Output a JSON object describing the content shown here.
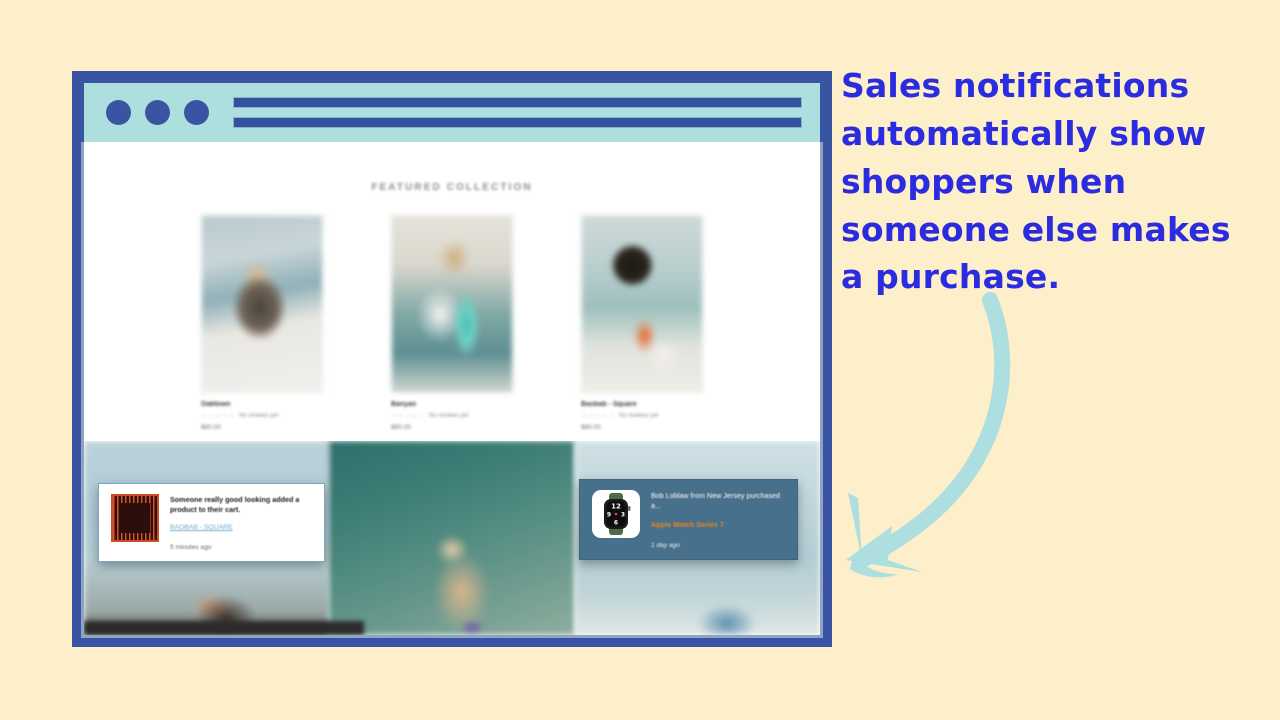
{
  "headline": "Sales notifications automatically show shoppers when someone else makes a purchase.",
  "colors": {
    "background": "#FCEFC9",
    "frame_blue": "#3A54A4",
    "chrome_teal": "#AEDFDF",
    "headline_blue": "#2B2BE0",
    "arrow_teal": "#ADDEE0",
    "notification_right_bg": "#46708C",
    "product_link_orange": "#E8871E",
    "product_link_blue": "#6FA8CF"
  },
  "browser": {
    "chrome": {
      "dots": [
        "window-dot-red",
        "window-dot-yellow",
        "window-dot-green"
      ],
      "address_bars": 2
    },
    "page": {
      "collection_title": "FEATURED COLLECTION",
      "products": [
        {
          "name": "Oaktown",
          "stars": "☆☆☆☆☆",
          "reviews": "No reviews yet",
          "price": "$80.00"
        },
        {
          "name": "Banyan",
          "stars": "☆☆☆☆☆",
          "reviews": "No reviews yet",
          "price": "$80.00"
        },
        {
          "name": "Baobab - Square",
          "stars": "☆☆☆☆☆",
          "reviews": "No reviews yet",
          "price": "$80.00"
        }
      ]
    }
  },
  "notifications": [
    {
      "id": "cart-notification",
      "thumb": "rug-thumbnail",
      "message": "Someone really good looking added a product to their cart.",
      "product": "BAOBAB - SQUARE",
      "time": "5 minutes ago"
    },
    {
      "id": "purchase-notification",
      "thumb": "apple-watch-thumbnail",
      "message": "Bob Loblaw from New Jersey purchased a...",
      "product": "Apple Watch Series 7",
      "time": "1 day ago"
    }
  ],
  "watch_face": {
    "twelve": "12",
    "three": "3",
    "six": "6",
    "nine": "9"
  }
}
